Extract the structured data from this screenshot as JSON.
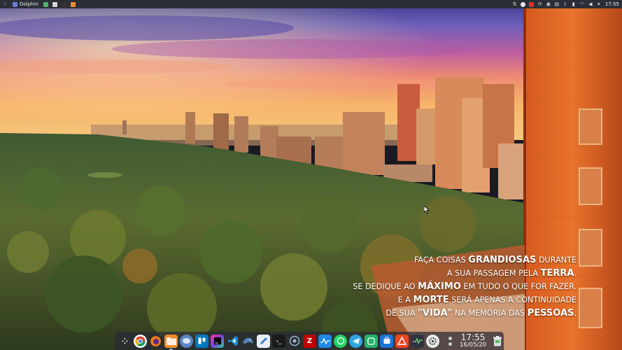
{
  "top_panel": {
    "launcher_icon": "kde-launcher-icon",
    "active_task_label": "Dolphin",
    "clock": "17:55",
    "tray_icons": [
      "network-icon",
      "media-icon",
      "mail-icon",
      "sync-icon",
      "update-icon",
      "clipboard-icon",
      "bluetooth-icon",
      "battery-icon",
      "wifi-icon",
      "volume-icon",
      "notification-icon"
    ]
  },
  "quote": {
    "l1_a": "FAÇA COISAS ",
    "l1_b": "GRANDIOSAS",
    "l1_c": " DURANTE",
    "l2_a": "A SUA PASSAGEM PELA ",
    "l2_b": "TERRA",
    "l2_c": ".",
    "l3_a": "SE DEDIQUE AO ",
    "l3_b": "MÁXIMO",
    "l3_c": " EM TUDO O QUE FOR FAZER.",
    "l4_a": "E A ",
    "l4_b": "MORTE",
    "l4_c": " SERÁ APENAS A CONTINUIDADE",
    "l5_a": "DE SUA ",
    "l5_b": "\"VIDA\"",
    "l5_c": " NA MEMÓRIA DAS ",
    "l5_d": "PESSOAS",
    "l5_e": "."
  },
  "dock": {
    "clock_time": "17:55",
    "clock_date": "16/05/20",
    "apps": [
      "launcher",
      "chrome",
      "firefox",
      "dolphin-files",
      "gimp",
      "trello",
      "phpstorm",
      "vscode",
      "mysql-workbench",
      "kwrite",
      "terminal",
      "screenshot",
      "filezilla",
      "activity-monitor",
      "whatsapp",
      "telegram",
      "snapshot",
      "discover",
      "anydesk",
      "system-monitor",
      "settings"
    ]
  },
  "colors": {
    "panel": "#2b2e36",
    "dock": "#282a34",
    "accent": "#7ab8ff"
  }
}
